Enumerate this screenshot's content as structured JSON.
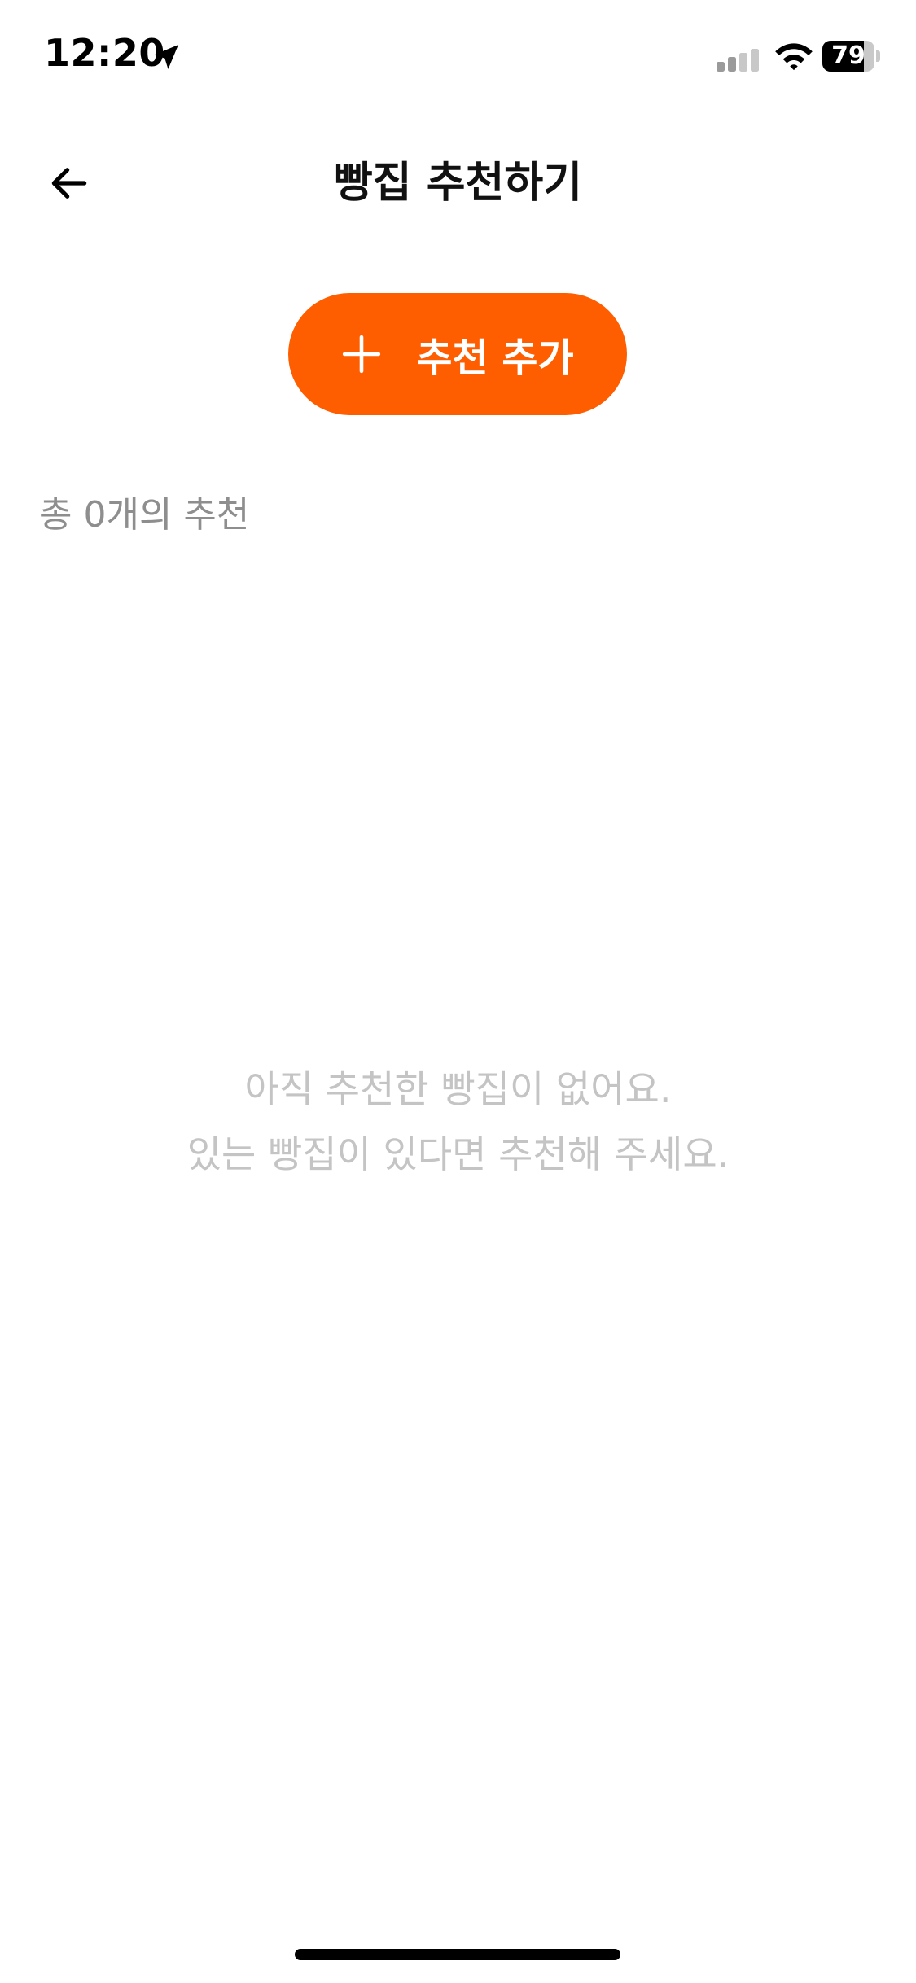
{
  "status_bar": {
    "time": "12:20",
    "battery_level": "79",
    "battery_fraction": 0.79,
    "icons": [
      "location-arrow-icon",
      "cellular-signal-icon",
      "wifi-icon",
      "battery-icon"
    ]
  },
  "header": {
    "title": "빵집 추천하기",
    "back_icon": "arrow-left-icon"
  },
  "add_button": {
    "label": "추천 추가",
    "icon": "plus-icon",
    "color": "#ff5e00"
  },
  "summary": {
    "count_text": "총 0개의 추천"
  },
  "empty_state": {
    "line1": "아직 추천한 빵집이 없어요.",
    "line2": "있는 빵집이 있다면 추천해 주세요."
  },
  "colors": {
    "accent": "#ff5e00",
    "muted_text": "#8e8e8e",
    "empty_text": "#c4c4c4"
  }
}
